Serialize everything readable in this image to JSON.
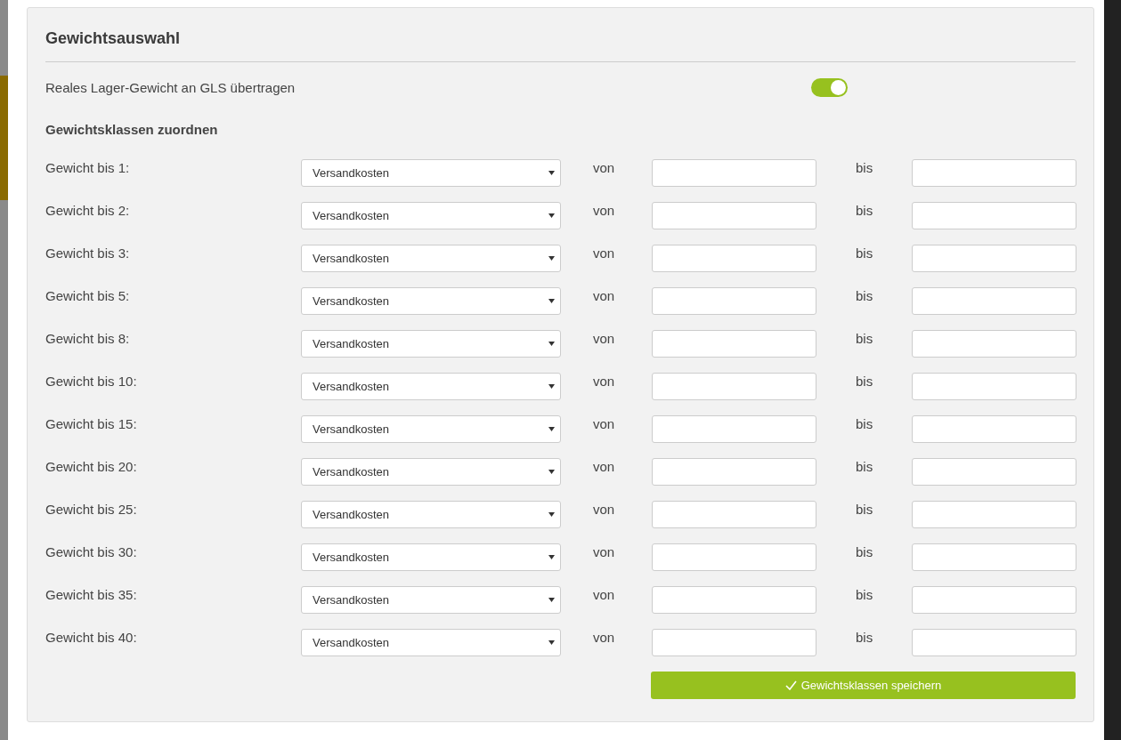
{
  "panel": {
    "title": "Gewichtsauswahl"
  },
  "setting": {
    "label": "Reales Lager-Gewicht an GLS übertragen",
    "on": true
  },
  "section_title": "Gewichtsklassen zuordnen",
  "rows": [
    {
      "label": "Gewicht bis 1:",
      "select": "Versandkosten",
      "from_label": "von",
      "to_label": "bis"
    },
    {
      "label": "Gewicht bis 2:",
      "select": "Versandkosten",
      "from_label": "von",
      "to_label": "bis"
    },
    {
      "label": "Gewicht bis 3:",
      "select": "Versandkosten",
      "from_label": "von",
      "to_label": "bis"
    },
    {
      "label": "Gewicht bis 5:",
      "select": "Versandkosten",
      "from_label": "von",
      "to_label": "bis"
    },
    {
      "label": "Gewicht bis 8:",
      "select": "Versandkosten",
      "from_label": "von",
      "to_label": "bis"
    },
    {
      "label": "Gewicht bis 10:",
      "select": "Versandkosten",
      "from_label": "von",
      "to_label": "bis"
    },
    {
      "label": "Gewicht bis 15:",
      "select": "Versandkosten",
      "from_label": "von",
      "to_label": "bis"
    },
    {
      "label": "Gewicht bis 20:",
      "select": "Versandkosten",
      "from_label": "von",
      "to_label": "bis"
    },
    {
      "label": "Gewicht bis 25:",
      "select": "Versandkosten",
      "from_label": "von",
      "to_label": "bis"
    },
    {
      "label": "Gewicht bis 30:",
      "select": "Versandkosten",
      "from_label": "von",
      "to_label": "bis"
    },
    {
      "label": "Gewicht bis 35:",
      "select": "Versandkosten",
      "from_label": "von",
      "to_label": "bis"
    },
    {
      "label": "Gewicht bis 40:",
      "select": "Versandkosten",
      "from_label": "von",
      "to_label": "bis"
    }
  ],
  "save_button": "Gewichtsklassen speichern"
}
